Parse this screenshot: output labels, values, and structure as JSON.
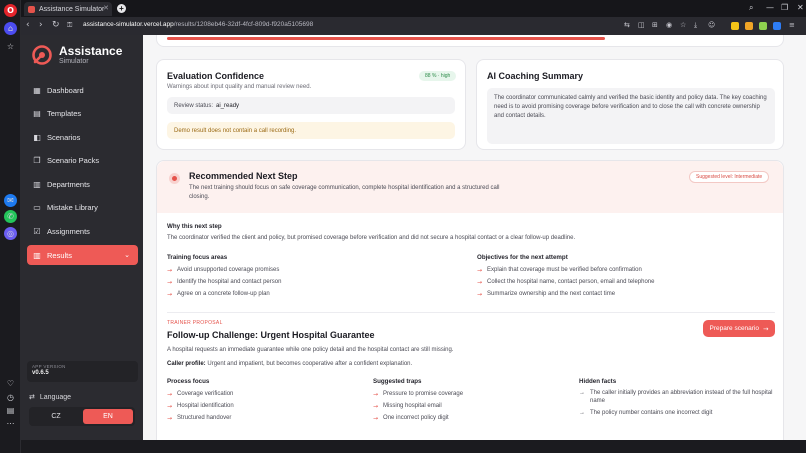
{
  "browser": {
    "tab_title": "Assistance Simulator",
    "url_host": "assistance-simulator.vercel.app",
    "url_path": "/results/1208eb46-32df-4fcf-809d-f920a5105698"
  },
  "sidebar": {
    "brand": "Assistance",
    "brand_sub": "Simulator",
    "items": [
      {
        "label": "Dashboard",
        "icon": "dashboard-icon"
      },
      {
        "label": "Templates",
        "icon": "document-icon"
      },
      {
        "label": "Scenarios",
        "icon": "scenario-icon"
      },
      {
        "label": "Scenario Packs",
        "icon": "pack-icon"
      },
      {
        "label": "Departments",
        "icon": "building-icon"
      },
      {
        "label": "Mistake Library",
        "icon": "book-icon"
      },
      {
        "label": "Assignments",
        "icon": "assignment-icon"
      },
      {
        "label": "Results",
        "icon": "results-icon"
      }
    ],
    "version_label": "APP VERSION",
    "version": "v0.6.5",
    "language_label": "Language",
    "lang_cz": "CZ",
    "lang_en": "EN",
    "accent": "#ee5a56"
  },
  "confidence": {
    "title": "Evaluation Confidence",
    "badge": "88 % · high",
    "subtitle": "Warnings about input quality and manual review need.",
    "review_label": "Review status:",
    "review_value": "ai_ready",
    "warning": "Demo result does not contain a call recording."
  },
  "coaching": {
    "title": "AI Coaching Summary",
    "text": "The coordinator communicated calmly and verified the basic identity and policy data. The key coaching need is to avoid promising coverage before verification and to close the call with concrete ownership and contact details."
  },
  "next_step": {
    "title": "Recommended Next Step",
    "level": "Suggested level: Intermediate",
    "text": "The next training should focus on safe coverage communication, complete hospital identification and a structured call closing.",
    "why_title": "Why this next step",
    "why_text": "The coordinator verified the client and policy, but promised coverage before verification and did not secure a hospital contact or a clear follow-up deadline.",
    "focus_title": "Training focus areas",
    "focus": [
      "Avoid unsupported coverage promises",
      "Identify the hospital and contact person",
      "Agree on a concrete follow-up plan"
    ],
    "objectives_title": "Objectives for the next attempt",
    "objectives": [
      "Explain that coverage must be verified before confirmation",
      "Collect the hospital name, contact person, email and telephone",
      "Summarize ownership and the next contact time"
    ],
    "proposal_label": "TRAINER PROPOSAL",
    "proposal_title": "Follow-up Challenge: Urgent Hospital Guarantee",
    "prepare_button": "Prepare scenario",
    "proposal_text": "A hospital requests an immediate guarantee while one policy detail and the hospital contact are still missing.",
    "caller_label": "Caller profile:",
    "caller_text": "Urgent and impatient, but becomes cooperative after a confident explanation.",
    "process_title": "Process focus",
    "process": [
      "Coverage verification",
      "Hospital identification",
      "Structured handover"
    ],
    "traps_title": "Suggested traps",
    "traps": [
      "Pressure to promise coverage",
      "Missing hospital email",
      "One incorrect policy digit"
    ],
    "facts_title": "Hidden facts",
    "facts": [
      "The caller initially provides an abbreviation instead of the full hospital name",
      "The policy number contains one incorrect digit"
    ]
  }
}
